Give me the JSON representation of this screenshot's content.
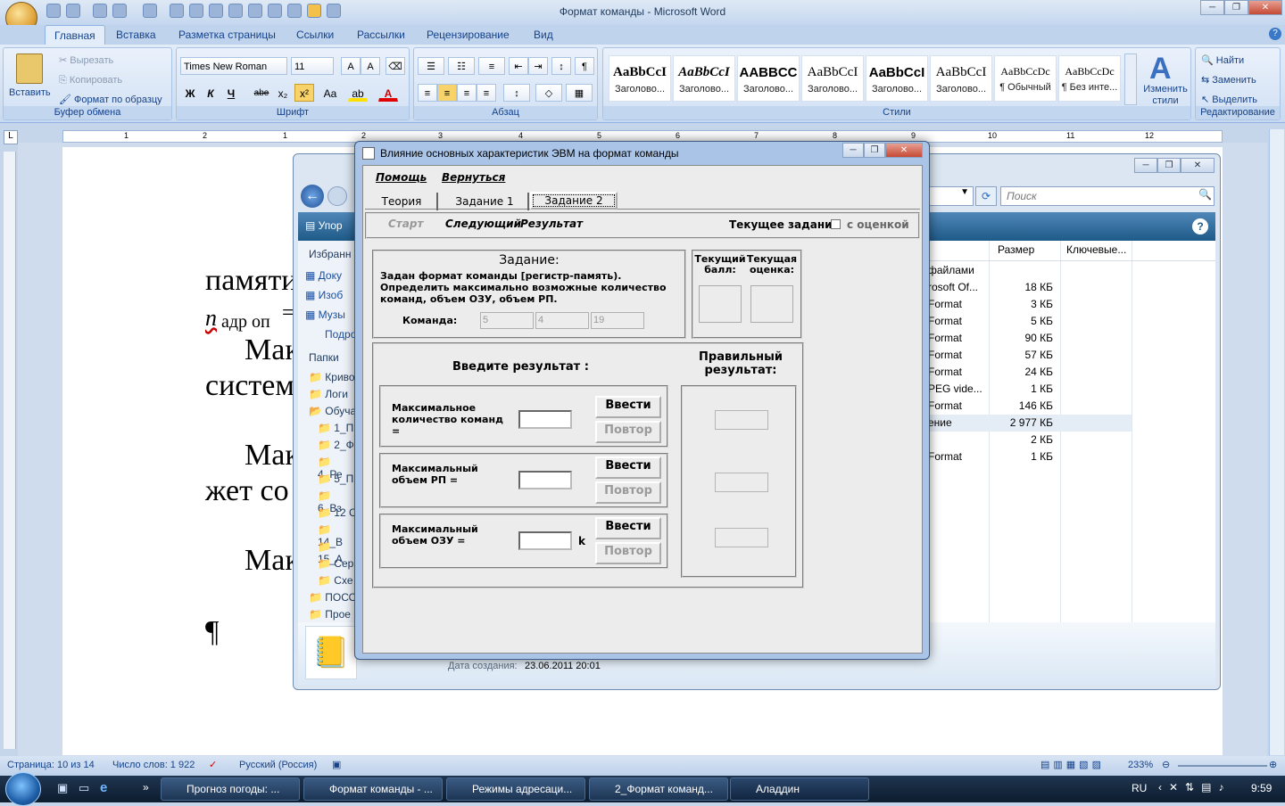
{
  "window_title": "Формат команды - Microsoft Word",
  "ribbon_tabs": [
    "Главная",
    "Вставка",
    "Разметка страницы",
    "Ссылки",
    "Рассылки",
    "Рецензирование",
    "Вид"
  ],
  "clipboard": {
    "paste": "Вставить",
    "cut": "Вырезать",
    "copy": "Копировать",
    "format_painter": "Формат по образцу",
    "label": "Буфер обмена"
  },
  "font": {
    "name": "Times New Roman",
    "size": "11",
    "label": "Шрифт",
    "bold": "Ж",
    "italic": "К",
    "underline": "Ч",
    "strike": "abe",
    "sub": "x₂",
    "sup": "x²",
    "case": "Aa"
  },
  "paragraph": {
    "label": "Абзац"
  },
  "styles": {
    "label": "Стили",
    "items": [
      {
        "sample": "AaBbCcI",
        "name": "Заголово..."
      },
      {
        "sample": "AaBbCcI",
        "name": "Заголово..."
      },
      {
        "sample": "AABBCC",
        "name": "Заголово..."
      },
      {
        "sample": "AaBbCcI",
        "name": "Заголово..."
      },
      {
        "sample": "AaBbCcI",
        "name": "Заголово..."
      },
      {
        "sample": "AaBbCcI",
        "name": "Заголово..."
      },
      {
        "sample": "AaBbCcDc",
        "name": "¶ Обычный"
      },
      {
        "sample": "AaBbCcDc",
        "name": "¶ Без инте..."
      }
    ],
    "change": "Изменить стили"
  },
  "editing": {
    "find": "Найти",
    "replace": "Заменить",
    "select": "Выделить",
    "label": "Редактирование"
  },
  "ruler_numbers": [
    "1",
    "2",
    "1",
    "2",
    "3",
    "4",
    "5",
    "6",
    "7",
    "8",
    "9",
    "10",
    "11",
    "12"
  ],
  "document_lines": [
    "памяти",
    "n",
    "адр оп",
    "=",
    "Мак",
    "систем",
    "Мак",
    "жет со",
    "Мак",
    "¶"
  ],
  "explorer": {
    "search_placeholder": "Поиск",
    "organize": "Упор",
    "favorites": "Избранн",
    "nav_items": [
      "Доку",
      "Изоб",
      "Музы",
      "Подро"
    ],
    "folders_label": "Папки",
    "folders": [
      "Криво",
      "Логи",
      "Обуча",
      "1_П",
      "2_Ф",
      "4_Ре",
      "5_П",
      "6_Вз",
      "12 С",
      "14_В",
      "15_А",
      "Серг",
      "Схе",
      "ПОСО",
      "Прое"
    ],
    "columns": {
      "size": "Размер",
      "keywords": "Ключевые..."
    },
    "rows": [
      {
        "name": "файлами",
        "size": ""
      },
      {
        "name": "rosoft Of...",
        "size": "18 КБ"
      },
      {
        "name": "Format",
        "size": "3 КБ"
      },
      {
        "name": "Format",
        "size": "5 КБ"
      },
      {
        "name": "Format",
        "size": "90 КБ"
      },
      {
        "name": "Format",
        "size": "57 КБ"
      },
      {
        "name": "Format",
        "size": "24 КБ"
      },
      {
        "name": "PEG vide...",
        "size": "1 КБ"
      },
      {
        "name": "Format",
        "size": "146 КБ"
      },
      {
        "name": "ение",
        "size": "2 977 КБ"
      },
      {
        "name": "",
        "size": "2 КБ"
      },
      {
        "name": "Format",
        "size": "1 КБ"
      }
    ],
    "created_label": "Дата создания:",
    "created_value": "23.06.2011 20:01"
  },
  "dialog": {
    "title": "Влияние основных характеристик ЭВМ на формат команды",
    "menu": {
      "help": "Помощь",
      "back": "Вернуться"
    },
    "tabs": [
      "Теория",
      "Задание 1",
      "Задание 2"
    ],
    "toolbar": {
      "start": "Старт",
      "next": "Следующий",
      "result": "Результат",
      "current_task": "Текущее задание",
      "with_grade": "с оценкой"
    },
    "task": {
      "heading": "Задание:",
      "text": "Задан формат команды [регистр-память). Определить максимально возможные количество команд, объем ОЗУ, объем РП.",
      "command_label": "Команда:",
      "fields": [
        "5",
        "4",
        "19"
      ]
    },
    "score": {
      "current_score": "Текущий балл:",
      "current_grade": "Текущая оценка:"
    },
    "input": {
      "heading": "Введите результат :",
      "correct_heading": "Правильный результат:",
      "rows": [
        {
          "label": "Максимальное количество команд =",
          "enter": "Ввести",
          "repeat": "Повтор",
          "unit": ""
        },
        {
          "label": "Максимальный объем РП =",
          "enter": "Ввести",
          "repeat": "Повтор",
          "unit": ""
        },
        {
          "label": "Максимальный объем ОЗУ =",
          "enter": "Ввести",
          "repeat": "Повтор",
          "unit": "k"
        }
      ]
    }
  },
  "statusbar": {
    "page": "Страница: 10 из 14",
    "words": "Число слов: 1 922",
    "lang": "Русский (Россия)",
    "zoom": "233%"
  },
  "taskbar": {
    "items": [
      "Прогноз погоды: ...",
      "Формат команды - ...",
      "Режимы адресаци...",
      "2_Формат команд...",
      "Аладдин"
    ],
    "lang": "RU",
    "time": "9:59"
  }
}
